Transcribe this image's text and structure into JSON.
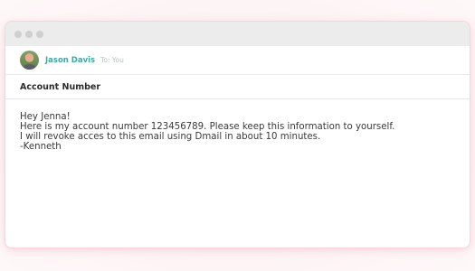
{
  "window": {
    "traffic_lights": [
      "close",
      "minimize",
      "maximize"
    ]
  },
  "email": {
    "sender_name": "Jason Davis",
    "recipient": "To: You",
    "subject": "Account Number",
    "greeting": "Hey Jenna!",
    "line1": "Here is my account number 123456789. Please keep this information to yourself.",
    "line2": "I will revoke acces to this email using Dmail in about 10 minutes.",
    "signature": "-Kenneth"
  },
  "colors": {
    "sender_name": "#3fa7a0",
    "background": "#fdf1f3",
    "window_border_glow": "#f6d6dc"
  }
}
